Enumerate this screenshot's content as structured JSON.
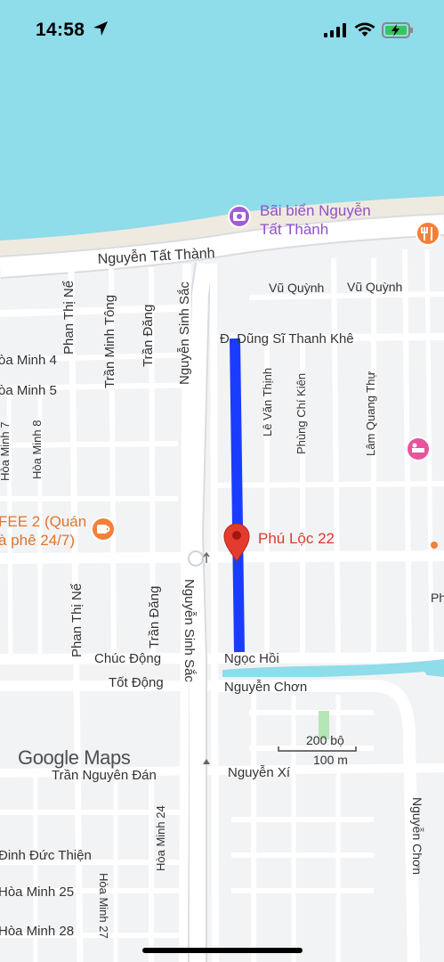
{
  "status_bar": {
    "time": "14:58"
  },
  "map": {
    "app": "Google Maps",
    "colors": {
      "water": "#8fdcea",
      "land": "#f2f3f5",
      "road": "#ffffff",
      "route": "#1a3cff",
      "pin": "#e33b2e",
      "poi_orange": "#f2803a",
      "poi_pink": "#e8549a",
      "poi_purple": "#a05cd8",
      "park": "#a8e0a8"
    },
    "poi": {
      "beach": "Bãi biển Nguyễn\nTất Thành",
      "cafe": "FEE 2 (Quán\nà phê 24/7)"
    },
    "pin_label": "Phú Lộc 22",
    "roads": {
      "nguyen_tat_thanh": "Nguyễn Tất Thành",
      "vu_quynh_1": "Vũ Quỳnh",
      "vu_quynh_2": "Vũ Quỳnh",
      "dung_si": "Đ. Dũng Sĩ Thanh Khê",
      "phan_thi_ne_top": "Phan Thị Nể",
      "tran_minh_tong": "Trần Minh Tông",
      "tran_dang_top": "Trần Đăng",
      "nguyen_sinh_sac_top": "Nguyễn Sinh Sắc",
      "hoa_minh_4": "òa Minh 4",
      "hoa_minh_5": "òa Minh 5",
      "hoa_minh_7": "Hòa Minh 7",
      "hoa_minh_8": "Hòa Minh 8",
      "le_van_thinh": "Lê Văn Thịnh",
      "phung_chi_kien": "Phùng Chí Kiên",
      "lam_quang_thu": "Lâm Quang Thự",
      "phan_thi_ne_bottom": "Phan Thị Nể",
      "tran_dang_bottom": "Trần Đăng",
      "nguyen_sinh_sac_bottom": "Nguyễn Sinh Sắc",
      "ph": "Ph",
      "chuc_dong": "Chúc Động",
      "ngoc_hoi": "Ngọc Hồi",
      "tot_dong": "Tốt Động",
      "nguyen_chon": "Nguyễn Chơn",
      "tran_nguyen_dan": "Trần Nguyên Đán",
      "nguyen_xi": "Nguyễn Xí",
      "hoa_minh_24": "Hòa Minh 24",
      "nguyen_chon_vertical": "Nguyễn Chơn",
      "dinh_duc_thien": "Đinh Đức Thiện",
      "hoa_minh_25": "Hòa Minh 25",
      "hoa_minh_27": "Hòa Minh 27",
      "hoa_minh_28": "Hòa Minh 28"
    },
    "scale": {
      "top": "200 bộ",
      "bottom": "100 m"
    }
  }
}
